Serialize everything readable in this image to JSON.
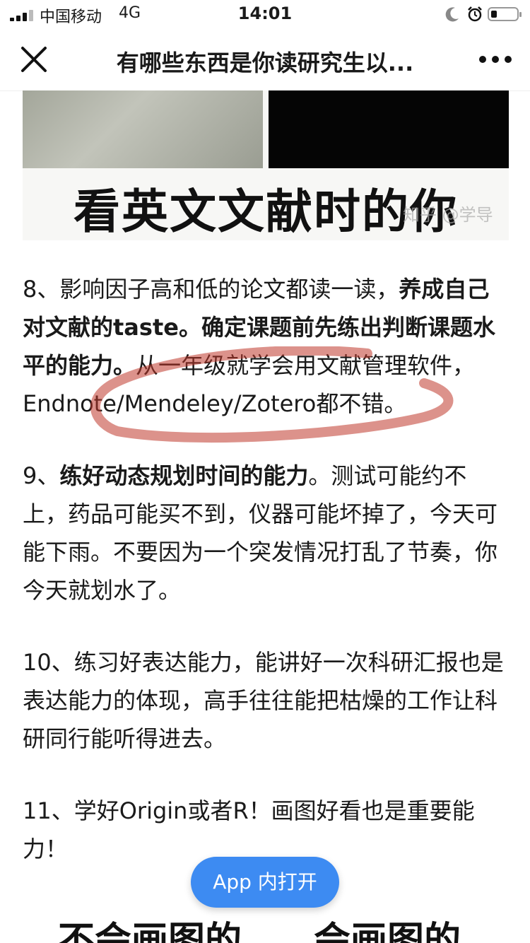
{
  "status_bar": {
    "carrier": "中国移动",
    "network": "4G",
    "time": "14:01",
    "icons": [
      "signal-icon",
      "moon-icon",
      "alarm-icon",
      "battery-icon"
    ]
  },
  "nav": {
    "title": "有哪些东西是你读研究生以...",
    "close_icon": "close-icon",
    "more_icon": "more-icon"
  },
  "top_image": {
    "caption": "看英文文献时的你",
    "watermark": "知乎 @学导"
  },
  "paragraphs": {
    "p8": {
      "a": "8、影响因子高和低的论文都读一读，",
      "b": "养成自己对文献的taste。确定课题前先练出判断课题水平的能力。",
      "c": "从一年级就学会用文献管理软件，Endnote/Mendeley/Zotero都不错。"
    },
    "p9": {
      "a": "9、",
      "b": "练好动态规划时间的能力",
      "c": "。测试可能约不上，药品可能买不到，仪器可能坏掉了，今天可能下雨。不要因为一个突发情况打乱了节奏，你今天就划水了。"
    },
    "p10": "10、练习好表达能力，能讲好一次科研汇报也是表达能力的体现，高手往往能把枯燥的工作让科研同行能听得进去。",
    "p11": "11、学好Origin或者R！画图好看也是重要能力！"
  },
  "open_app_label": "App 内打开",
  "bottom_image": {
    "left_caption": "不会画图的",
    "right_caption": "会画图的"
  },
  "colors": {
    "accent_button": "#3d8bf2",
    "highlight_stroke": "#c0392b"
  }
}
